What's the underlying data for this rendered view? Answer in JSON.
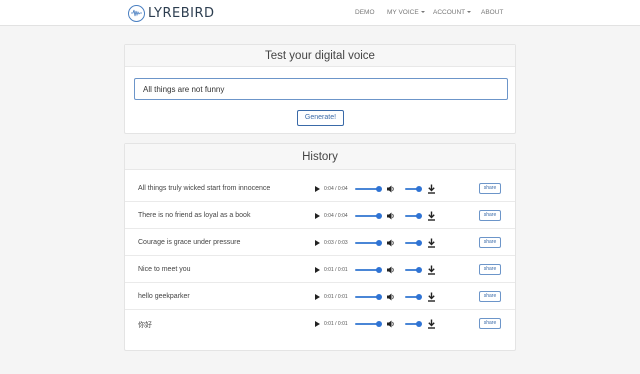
{
  "brand": {
    "name": "LYREBIRD",
    "logo_icon": "soundwave-logo-icon"
  },
  "nav": {
    "items": [
      {
        "label": "DEMO",
        "dropdown": false
      },
      {
        "label": "MY VOICE",
        "dropdown": true
      },
      {
        "label": "ACCOUNT",
        "dropdown": true
      },
      {
        "label": "ABOUT",
        "dropdown": false
      }
    ]
  },
  "test_panel": {
    "title": "Test your digital voice",
    "input_value": "All things are not funny",
    "generate_label": "Generate!"
  },
  "history": {
    "title": "History",
    "share_label": "share",
    "items": [
      {
        "text": "All things truly wicked start from innocence",
        "time": "0:04 / 0:04"
      },
      {
        "text": "There is no friend as loyal as a book",
        "time": "0:04 / 0:04"
      },
      {
        "text": "Courage is grace under pressure",
        "time": "0:03 / 0:03"
      },
      {
        "text": "Nice to meet you",
        "time": "0:01 / 0:01"
      },
      {
        "text": "hello geekparker",
        "time": "0:01 / 0:01"
      },
      {
        "text": "你好",
        "time": "0:01 / 0:01"
      }
    ]
  },
  "colors": {
    "accent": "#3a6aa8",
    "slider": "#2f73d4",
    "background": "#f5f5f5"
  }
}
